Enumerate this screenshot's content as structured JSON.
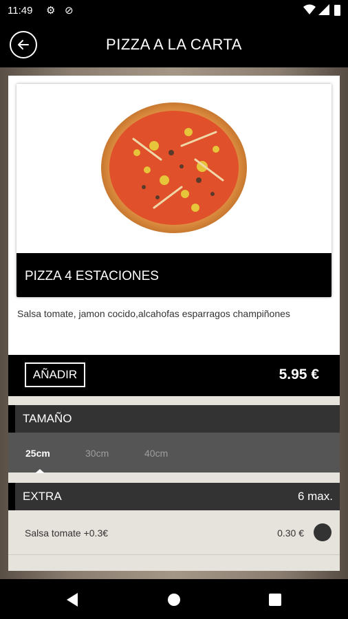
{
  "status_bar": {
    "time": "11:49",
    "icons": [
      "gear-icon",
      "do-not-disturb-icon",
      "wifi-icon",
      "cell-signal-icon",
      "battery-icon"
    ]
  },
  "app_bar": {
    "title": "PIZZA A LA CARTA",
    "back_icon": "arrow-left-circle-icon"
  },
  "product": {
    "name": "PIZZA 4 ESTACIONES",
    "description": "Salsa tomate, jamon cocido,alcahofas esparragos champiñones",
    "image": "pizza-photo"
  },
  "purchase": {
    "add_label": "AÑADIR",
    "price": "5.95 €"
  },
  "size_section": {
    "title": "TAMAÑO",
    "options": [
      {
        "label": "25cm",
        "active": true
      },
      {
        "label": "30cm",
        "active": false
      },
      {
        "label": "40cm",
        "active": false
      }
    ]
  },
  "extra_section": {
    "title": "EXTRA",
    "limit": "6 max.",
    "items": [
      {
        "name": "Salsa tomate +0.3€",
        "cost": "0.30 €",
        "selected": false
      }
    ]
  },
  "colors": {
    "app_bar": "#000000",
    "section_header": "#333333",
    "size_tabs_bg": "#555555",
    "panel_lower": "#e6e2dc"
  },
  "nav_bar": {
    "icons": [
      "nav-back-icon",
      "nav-home-icon",
      "nav-recents-icon"
    ]
  }
}
